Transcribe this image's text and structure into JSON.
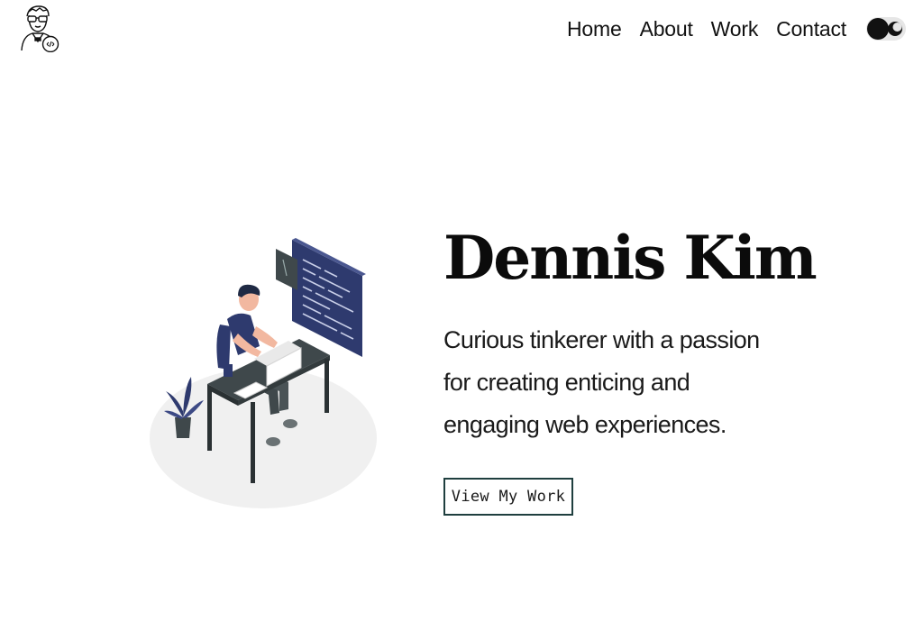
{
  "header": {
    "logo_icon": "developer-avatar-icon",
    "nav": [
      {
        "label": "Home"
      },
      {
        "label": "About"
      },
      {
        "label": "Work"
      },
      {
        "label": "Contact"
      }
    ],
    "theme_toggle": {
      "knob_icon": "dark-mode-circle-icon",
      "icon": "moon-icon"
    }
  },
  "hero": {
    "illustration_icon": "person-working-at-desk-illustration",
    "name": "Dennis Kim",
    "tagline": "Curious tinkerer with a passion for creating enticing and engaging web experiences.",
    "cta_label": "View My Work"
  },
  "colors": {
    "text": "#111111",
    "accent_navy": "#2e3a6e",
    "desk_gray": "#3f484b",
    "button_border": "#1f3f3f",
    "background": "#ffffff"
  }
}
